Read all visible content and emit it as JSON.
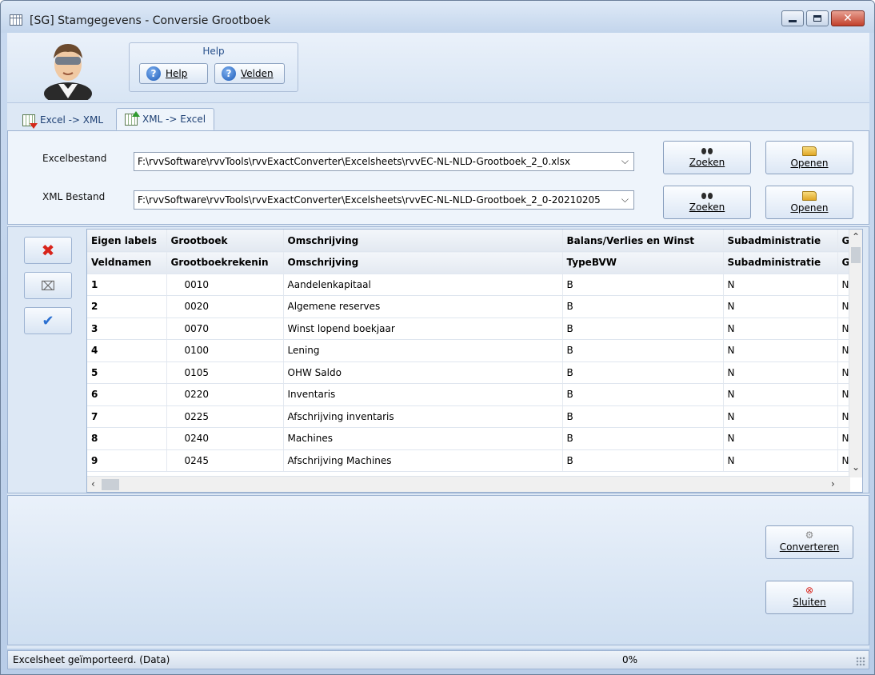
{
  "window": {
    "title": "[SG]  Stamgegevens - Conversie Grootboek"
  },
  "ribbon": {
    "group_title": "Help",
    "help_label": "Help",
    "velden_label": "Velden"
  },
  "tabs": [
    {
      "label": "Excel -> XML"
    },
    {
      "label": "XML -> Excel"
    }
  ],
  "form": {
    "excel_label": "Excelbestand",
    "excel_value": "F:\\rvvSoftware\\rvvTools\\rvvExactConverter\\Excelsheets\\rvvEC-NL-NLD-Grootboek_2_0.xlsx",
    "xml_label": "XML Bestand",
    "xml_value": "F:\\rvvSoftware\\rvvTools\\rvvExactConverter\\Excelsheets\\rvvEC-NL-NLD-Grootboek_2_0-20210205",
    "zoeken_label": "Zoeken",
    "openen_label": "Openen"
  },
  "grid": {
    "header1": [
      "Eigen labels",
      "Grootboek",
      "Omschrijving",
      "Balans/Verlies en Winst",
      "Subadministratie",
      "G"
    ],
    "header2": [
      "Veldnamen",
      "Grootboekrekenin",
      "Omschrijving",
      "TypeBVW",
      "Subadministratie",
      "G"
    ],
    "rows": [
      [
        "1",
        "0010",
        "Aandelenkapitaal",
        "B",
        "N",
        "N"
      ],
      [
        "2",
        "0020",
        "Algemene reserves",
        "B",
        "N",
        "N"
      ],
      [
        "3",
        "0070",
        "Winst lopend boekjaar",
        "B",
        "N",
        "N"
      ],
      [
        "4",
        "0100",
        "Lening",
        "B",
        "N",
        "N"
      ],
      [
        "5",
        "0105",
        "OHW Saldo",
        "B",
        "N",
        "N"
      ],
      [
        "6",
        "0220",
        "Inventaris",
        "B",
        "N",
        "N"
      ],
      [
        "7",
        "0225",
        "Afschrijving inventaris",
        "B",
        "N",
        "N"
      ],
      [
        "8",
        "0240",
        "Machines",
        "B",
        "N",
        "N"
      ],
      [
        "9",
        "0245",
        "Afschrijving Machines",
        "B",
        "N",
        "N"
      ]
    ]
  },
  "actions": {
    "converteren_label": "Converteren",
    "sluiten_label": "Sluiten"
  },
  "status": {
    "text": "Excelsheet geïmporteerd. (Data)",
    "progress": "0%"
  }
}
